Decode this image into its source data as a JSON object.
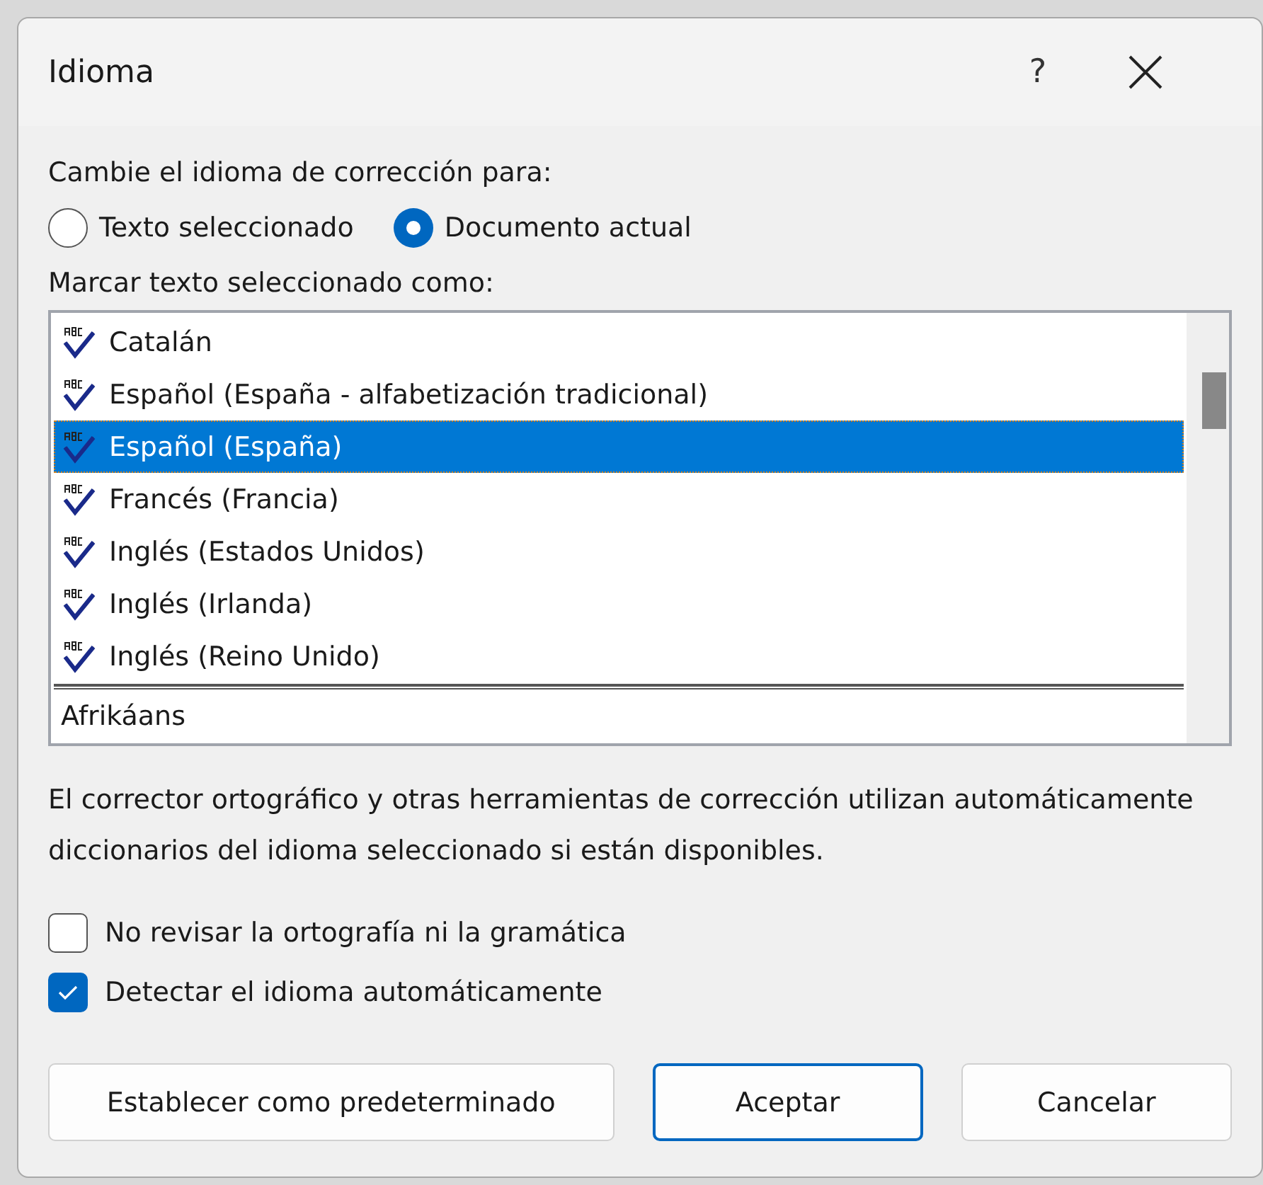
{
  "window": {
    "title": "Idioma",
    "help": "?"
  },
  "scope": {
    "label": "Cambie el idioma de corrección para:",
    "options": [
      {
        "label": "Texto seleccionado",
        "selected": false
      },
      {
        "label": "Documento actual",
        "selected": true
      }
    ]
  },
  "languages": {
    "label": "Marcar texto seleccionado como:",
    "groups": [
      [
        {
          "label": "Catalán",
          "proofing": true,
          "selected": false
        },
        {
          "label": "Español (España - alfabetización tradicional)",
          "proofing": true,
          "selected": false
        },
        {
          "label": "Español (España)",
          "proofing": true,
          "selected": true
        },
        {
          "label": "Francés (Francia)",
          "proofing": true,
          "selected": false
        },
        {
          "label": "Inglés (Estados Unidos)",
          "proofing": true,
          "selected": false
        },
        {
          "label": "Inglés (Irlanda)",
          "proofing": true,
          "selected": false
        },
        {
          "label": "Inglés (Reino Unido)",
          "proofing": true,
          "selected": false
        }
      ],
      [
        {
          "label": "Afrikáans",
          "proofing": false,
          "selected": false
        }
      ]
    ]
  },
  "description": "El corrector ortográfico y otras herramientas de corrección utilizan automáticamente diccionarios del idioma seleccionado si están disponibles.",
  "options": [
    {
      "label": "No revisar la ortografía ni la gramática",
      "checked": false
    },
    {
      "label": "Detectar el idioma automáticamente",
      "checked": true
    }
  ],
  "buttons": [
    {
      "label": "Establecer como predeterminado",
      "default": false
    },
    {
      "label": "Aceptar",
      "default": true
    },
    {
      "label": "Cancelar",
      "default": false
    }
  ]
}
